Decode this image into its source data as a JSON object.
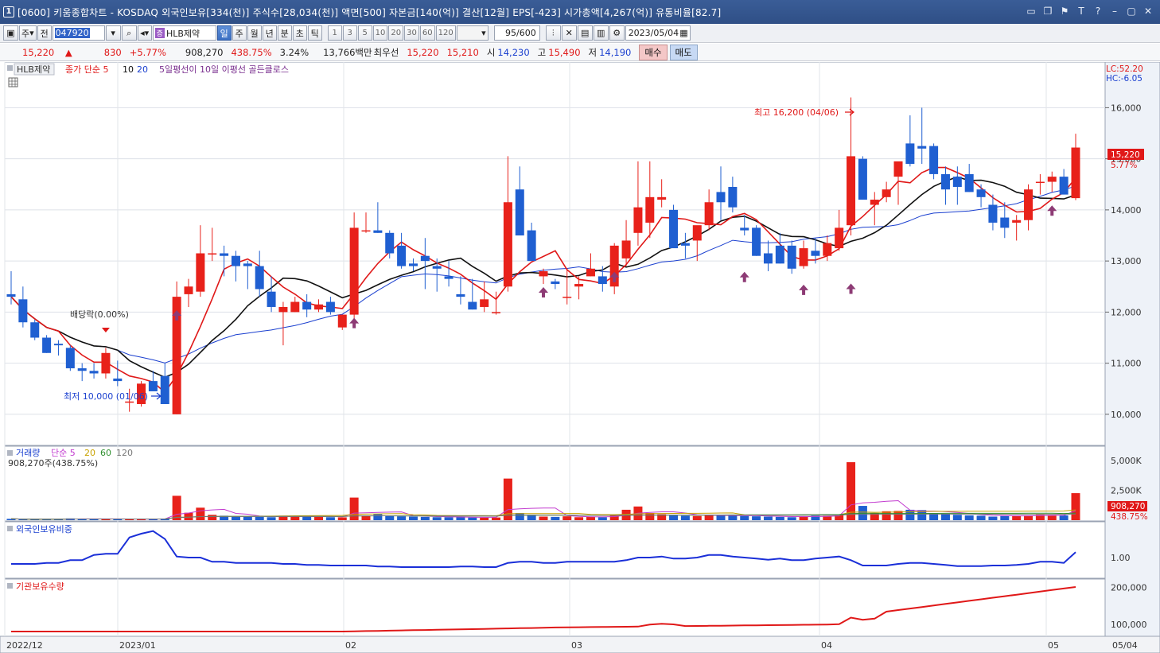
{
  "window": {
    "number": "1",
    "title": "[0600] 키움종합차트 - KOSDAQ 외국인보유[334(천)] 주식수[28,034(천)] 액면[500] 자본금[140(억)] 결산[12월] EPS[-423] 시가총액[4,267(억)] 유통비율[82.7]",
    "buttons": [
      "▭",
      "❐",
      "⚑",
      "T",
      "?",
      "–",
      "▢",
      "✕"
    ]
  },
  "toolbar": {
    "period_unit": "주",
    "prev_label": "전",
    "code": "047920",
    "stock_name": "HLB제약",
    "stock_badge": "증",
    "intervals": [
      "일",
      "주",
      "월",
      "년",
      "분",
      "초",
      "틱"
    ],
    "active_interval": "일",
    "numbers": [
      "1",
      "3",
      "5",
      "10",
      "20",
      "30",
      "60",
      "120"
    ],
    "count": "95",
    "count_total": "/600",
    "date": "2023/05/04"
  },
  "quote": {
    "price": "15,220",
    "arrow": "▲",
    "change": "830",
    "change_pct": "+5.77%",
    "volume": "908,270",
    "volume_ratio": "438.75%",
    "turnover": "3.24%",
    "amount": "13,766백만",
    "priority_label": "최우선",
    "ask": "15,220",
    "bid": "15,210",
    "open_label": "시",
    "open": "14,230",
    "high_label": "고",
    "high": "15,490",
    "low_label": "저",
    "low": "14,190",
    "buy_label": "매수",
    "sell_label": "매도"
  },
  "price_panel": {
    "stock_tag": "HLB제약",
    "legend": [
      {
        "text": "종가 단순 5",
        "color": "#e01818"
      },
      {
        "text": "10",
        "color": "#111111"
      },
      {
        "text": "20",
        "color": "#1a3fcf"
      },
      {
        "text": "5일평선이 10일 이평선 골든클로스",
        "color": "#7a2f8f"
      }
    ],
    "lc_label": "LC:52.20",
    "hc_label": "HC:-6.05",
    "y_ticks": [
      "16,000",
      "15,000",
      "14,000",
      "13,000",
      "12,000",
      "11,000",
      "10,000"
    ],
    "last_price": "15,220",
    "last_pct": "5.77%",
    "high_annotation": "최고 16,200 (04/06)",
    "low_annotation": "최저 10,000 (01/06)",
    "dividend_label": "배당락(0.00%)"
  },
  "volume_panel": {
    "legend": [
      {
        "text": "거래량",
        "color": "#1a3fcf"
      },
      {
        "text": "단순 5",
        "color": "#c23ccf"
      },
      {
        "text": "20",
        "color": "#c8a200"
      },
      {
        "text": "60",
        "color": "#2f8f2f"
      },
      {
        "text": "120",
        "color": "#777777"
      }
    ],
    "current": "908,270주(438.75%)",
    "y_ticks": [
      "5,000K",
      "2,500K"
    ],
    "last_volume": "908,270",
    "last_pct": "438.75%"
  },
  "foreign_panel": {
    "title": "외국인보유비중",
    "y_ticks": [
      "1.00"
    ]
  },
  "inst_panel": {
    "title": "기관보유수량",
    "y_ticks": [
      "200,000",
      "100,000"
    ]
  },
  "x_axis": [
    "2022/12",
    "2023/01",
    "02",
    "03",
    "04",
    "05",
    "05/04"
  ],
  "chart_data": {
    "type": "candlestick",
    "title": "HLB제약",
    "y_range": [
      9500,
      16800
    ],
    "candles": [
      [
        12350,
        12800,
        12150,
        12300
      ],
      [
        12250,
        12500,
        11700,
        11800
      ],
      [
        11800,
        11850,
        11450,
        11500
      ],
      [
        11500,
        11550,
        11200,
        11200
      ],
      [
        11380,
        11450,
        11150,
        11350
      ],
      [
        11300,
        11350,
        10850,
        10900
      ],
      [
        10900,
        11000,
        10650,
        10850
      ],
      [
        10850,
        11000,
        10700,
        10800
      ],
      [
        10800,
        11300,
        10700,
        11200
      ],
      [
        10700,
        11050,
        10550,
        10650
      ],
      [
        10250,
        10500,
        10050,
        10250
      ],
      [
        10200,
        10650,
        10150,
        10600
      ],
      [
        10650,
        10850,
        10550,
        10450
      ],
      [
        10750,
        11000,
        10200,
        10200
      ],
      [
        10000,
        12600,
        10000,
        12300
      ],
      [
        12350,
        12650,
        12100,
        12500
      ],
      [
        12400,
        13700,
        12300,
        13150
      ],
      [
        13150,
        13650,
        13000,
        13150
      ],
      [
        13150,
        13300,
        12700,
        13100
      ],
      [
        13100,
        13200,
        12600,
        12900
      ],
      [
        12950,
        13000,
        12450,
        12900
      ],
      [
        12900,
        13200,
        12300,
        12450
      ],
      [
        12400,
        12700,
        12000,
        12100
      ],
      [
        12000,
        12200,
        11350,
        12100
      ],
      [
        12000,
        12300,
        12000,
        12200
      ],
      [
        12200,
        12350,
        11900,
        12050
      ],
      [
        12050,
        12250,
        12000,
        12150
      ],
      [
        12200,
        12300,
        11950,
        12000
      ],
      [
        11700,
        11950,
        11650,
        11950
      ],
      [
        11950,
        13950,
        11850,
        13650
      ],
      [
        13600,
        13950,
        13550,
        13600
      ],
      [
        13600,
        14150,
        13550,
        13550
      ],
      [
        13550,
        13600,
        13050,
        13150
      ],
      [
        13300,
        13550,
        12850,
        12900
      ],
      [
        12950,
        13050,
        12800,
        12900
      ],
      [
        13100,
        13450,
        12450,
        13000
      ],
      [
        12900,
        13050,
        12400,
        12850
      ],
      [
        12700,
        13000,
        12500,
        12650
      ],
      [
        12350,
        12700,
        12150,
        12300
      ],
      [
        12200,
        12650,
        12050,
        12050
      ],
      [
        12100,
        12600,
        12000,
        12250
      ],
      [
        12000,
        12400,
        11950,
        12000
      ],
      [
        12500,
        15050,
        12400,
        14150
      ],
      [
        14400,
        14850,
        13750,
        13500
      ],
      [
        13600,
        13750,
        13000,
        13000
      ],
      [
        12700,
        12850,
        12550,
        12800
      ],
      [
        12600,
        12650,
        12450,
        12550
      ],
      [
        12300,
        12850,
        12150,
        12300
      ],
      [
        12500,
        12700,
        12250,
        12550
      ],
      [
        12700,
        13150,
        12700,
        12850
      ],
      [
        12700,
        12900,
        12400,
        12550
      ],
      [
        12500,
        13350,
        12350,
        13300
      ],
      [
        13050,
        13800,
        12900,
        13400
      ],
      [
        13550,
        14950,
        13300,
        14050
      ],
      [
        13750,
        14950,
        13450,
        14250
      ],
      [
        14200,
        14600,
        14050,
        14250
      ],
      [
        14000,
        14100,
        13300,
        13250
      ],
      [
        13350,
        13550,
        13050,
        13300
      ],
      [
        13400,
        13600,
        13000,
        13700
      ],
      [
        13700,
        14400,
        13600,
        14150
      ],
      [
        14350,
        14850,
        13800,
        14150
      ],
      [
        14450,
        14650,
        13950,
        14050
      ],
      [
        13650,
        13900,
        13500,
        13600
      ],
      [
        13650,
        13700,
        13100,
        13100
      ],
      [
        13150,
        13400,
        12800,
        12950
      ],
      [
        13300,
        13550,
        12950,
        12950
      ],
      [
        13300,
        13400,
        12750,
        12850
      ],
      [
        12900,
        13400,
        12850,
        13250
      ],
      [
        13200,
        13450,
        12950,
        13100
      ],
      [
        13100,
        13500,
        13000,
        13350
      ],
      [
        13250,
        14000,
        13200,
        13650
      ],
      [
        13700,
        16200,
        13500,
        15050
      ],
      [
        15000,
        15050,
        14200,
        14200
      ],
      [
        14100,
        14350,
        13700,
        14200
      ],
      [
        14250,
        14550,
        14150,
        14400
      ],
      [
        14650,
        14700,
        14100,
        14950
      ],
      [
        15300,
        15850,
        14850,
        14900
      ],
      [
        15250,
        16000,
        14900,
        15200
      ],
      [
        15250,
        15300,
        14600,
        14700
      ],
      [
        14700,
        14850,
        14100,
        14400
      ],
      [
        14650,
        14850,
        14100,
        14450
      ],
      [
        14700,
        14900,
        14350,
        14350
      ],
      [
        14400,
        14500,
        14050,
        14250
      ],
      [
        14100,
        14300,
        13600,
        13750
      ],
      [
        13850,
        14150,
        13450,
        13650
      ],
      [
        13750,
        13900,
        13400,
        13800
      ],
      [
        13800,
        14500,
        13600,
        14400
      ],
      [
        14550,
        14700,
        14300,
        14550
      ],
      [
        14550,
        14750,
        14350,
        14650
      ],
      [
        14650,
        14800,
        14450,
        14300
      ],
      [
        14230,
        15490,
        14190,
        15220
      ]
    ],
    "volume": [
      45,
      30,
      28,
      40,
      35,
      60,
      45,
      40,
      38,
      36,
      35,
      42,
      38,
      55,
      820,
      250,
      420,
      180,
      150,
      130,
      120,
      110,
      100,
      150,
      140,
      120,
      110,
      100,
      95,
      760,
      160,
      200,
      140,
      130,
      120,
      110,
      100,
      100,
      110,
      90,
      85,
      90,
      1400,
      240,
      180,
      120,
      110,
      130,
      100,
      110,
      100,
      160,
      350,
      460,
      240,
      200,
      160,
      150,
      140,
      180,
      170,
      150,
      140,
      130,
      120,
      110,
      100,
      130,
      150,
      140,
      200,
      1950,
      480,
      240,
      300,
      310,
      350,
      340,
      240,
      200,
      180,
      160,
      150,
      120,
      140,
      150,
      160,
      180,
      170,
      160,
      908
    ]
  }
}
